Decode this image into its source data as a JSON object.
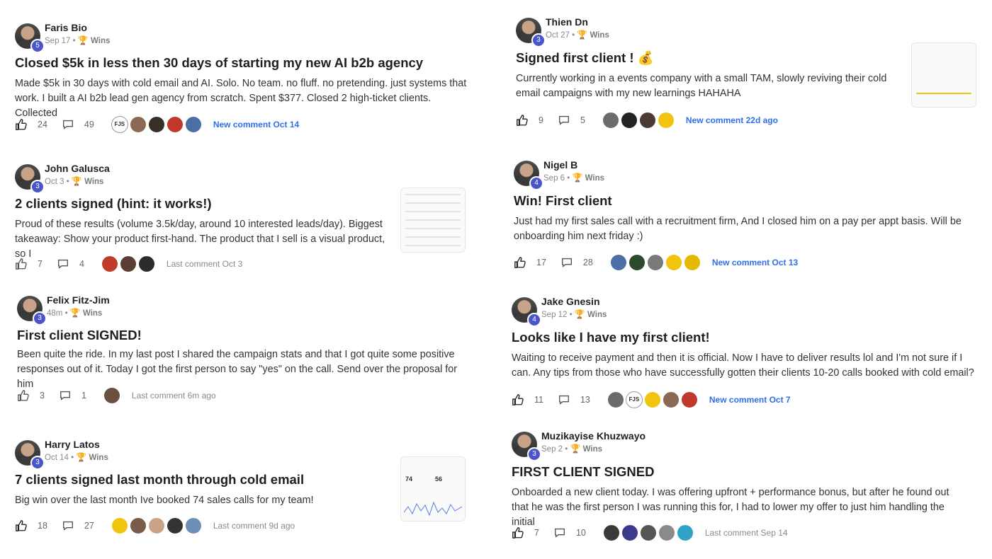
{
  "posts": [
    {
      "author": "Faris Bio",
      "level": "5",
      "date": "Sep 17",
      "category": "Wins",
      "title": "Closed $5k in less then 30 days of starting my new AI b2b agency",
      "body": "Made $5k in 30 days with cold email and AI. Solo. No team. no fluff. no pretending. just systems that work. I built a AI b2b lead gen agency from scratch. Spent $377. Closed 2 high-ticket clients. Collected",
      "likes": "24",
      "comments": "49",
      "avatars": [
        "FJS",
        "",
        "",
        "",
        ""
      ],
      "activity": "New comment Oct 14",
      "activity_type": "new"
    },
    {
      "author": "John Galusca",
      "level": "3",
      "date": "Oct 3",
      "category": "Wins",
      "title": "2 clients signed (hint: it works!)",
      "body": "Proud of these results (volume 3.5k/day, around 10 interested leads/day). Biggest takeaway: Show your product first-hand. The product that I sell is a visual product, so I",
      "likes": "7",
      "comments": "4",
      "avatars": [
        "",
        "",
        ""
      ],
      "activity": "Last comment Oct 3",
      "activity_type": "last"
    },
    {
      "author": "Felix Fitz-Jim",
      "level": "3",
      "date": "48m",
      "category": "Wins",
      "title": "First client SIGNED!",
      "body": "Been quite the ride. In my last post I shared the campaign stats and that I got quite some positive responses out of it. Today I got the first person to say \"yes\" on the call. Send over the proposal for him",
      "likes": "3",
      "comments": "1",
      "avatars": [
        ""
      ],
      "activity": "Last comment 6m ago",
      "activity_type": "last"
    },
    {
      "author": "Harry Latos",
      "level": "3",
      "date": "Oct 14",
      "category": "Wins",
      "title": "7 clients signed last month through cold email",
      "body": "Big win over the last month Ive booked 74 sales calls for my team!",
      "likes": "18",
      "comments": "27",
      "avatars": [
        "",
        "",
        "",
        "",
        ""
      ],
      "activity": "Last comment 9d ago",
      "activity_type": "last"
    },
    {
      "author": "Thien Dn",
      "level": "3",
      "date": "Oct 27",
      "category": "Wins",
      "title": "Signed first client ! 💰",
      "body": "Currently working in a events company with a small TAM, slowly reviving their cold email campaigns with my new learnings HAHAHA",
      "likes": "9",
      "comments": "5",
      "avatars": [
        "",
        "",
        "",
        ""
      ],
      "activity": "New comment 22d ago",
      "activity_type": "new"
    },
    {
      "author": "Nigel B",
      "level": "4",
      "date": "Sep 6",
      "category": "Wins",
      "title": "Win! First client",
      "body": "Just had my first sales call with a recruitment firm, And I closed him on a pay per appt basis. Will be onboarding him next friday :)",
      "likes": "17",
      "comments": "28",
      "avatars": [
        "",
        "",
        "",
        "",
        ""
      ],
      "activity": "New comment Oct 13",
      "activity_type": "new"
    },
    {
      "author": "Jake Gnesin",
      "level": "4",
      "date": "Sep 12",
      "category": "Wins",
      "title": "Looks like I have my first client!",
      "body": "Waiting to receive payment and then it is official. Now I have to deliver results lol and I'm not sure if I can. Any tips from those who have successfully gotten their clients 10-20 calls booked with cold email?",
      "likes": "11",
      "comments": "13",
      "avatars": [
        "",
        "FJS",
        "",
        "",
        ""
      ],
      "activity": "New comment Oct 7",
      "activity_type": "new"
    },
    {
      "author": "Muzikayise Khuzwayo",
      "level": "3",
      "date": "Sep 2",
      "category": "Wins",
      "title": "FIRST CLIENT SIGNED",
      "body": "Onboarded a new client today. I was offering upfront + performance bonus, but after he found out that he was the first person I was running this for, I had to lower my offer to just him handling the initial",
      "likes": "7",
      "comments": "10",
      "avatars": [
        "",
        "",
        "",
        "",
        ""
      ],
      "activity": "Last comment Sep 14",
      "activity_type": "last"
    }
  ],
  "thumbnails": {
    "harry_stats": [
      "74",
      "56"
    ]
  },
  "colors": {
    "level_badge": "#4a56c8",
    "new_comment": "#2f6fea",
    "trophy": "#c98a00"
  }
}
